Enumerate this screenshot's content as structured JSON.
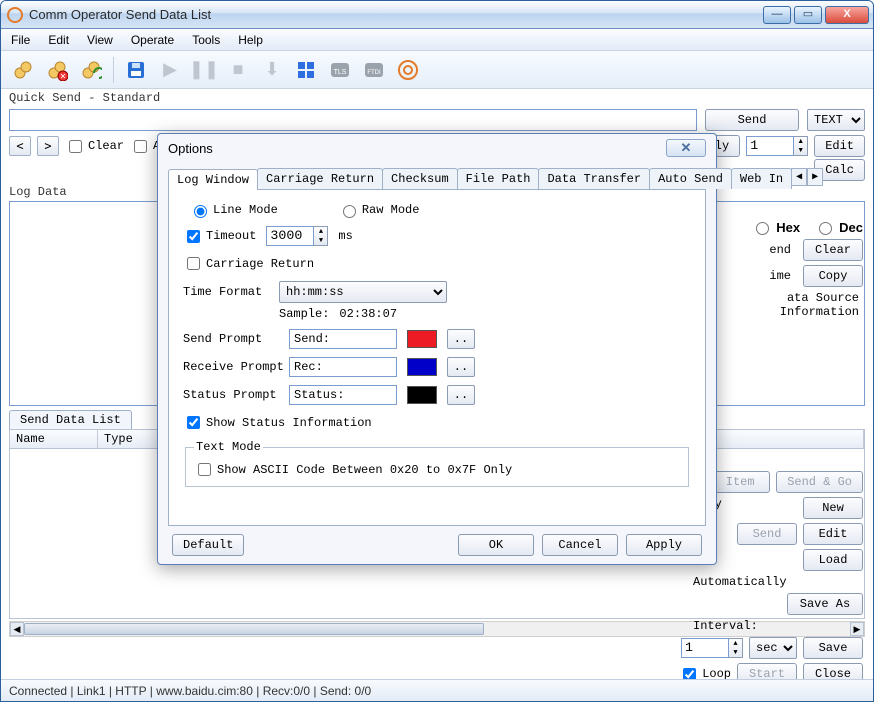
{
  "window": {
    "title": "Comm Operator   Send Data List"
  },
  "menubar": [
    "File",
    "Edit",
    "View",
    "Operate",
    "Tools",
    "Help"
  ],
  "quicksend_label": "Quick Send - Standard",
  "buttons": {
    "send": "Send",
    "text": "TEXT",
    "edit": "Edit",
    "calc": "Calc",
    "repeatedly": "Repeatedly",
    "clear": "Clear",
    "copy": "Copy",
    "item": "Item",
    "sendgo": "Send & Go",
    "new": "New",
    "load": "Load",
    "saveas": "Save As",
    "save": "Save",
    "close": "Close",
    "start": "Start",
    "send2": "Send"
  },
  "row2": {
    "clear": "Clear",
    "a_label": "A",
    "repeat_value": "1"
  },
  "log_label": "Log Data",
  "hexdec": {
    "hex": "Hex",
    "dec": "Dec"
  },
  "right_labels": {
    "end": "end",
    "ime": "ime",
    "datasrc": "ata Source Information",
    "edly": "edly",
    "auto": "Automatically",
    "interval": "Interval:",
    "loop": "Loop"
  },
  "interval": {
    "value": "1",
    "unit": "sec"
  },
  "sdl": {
    "tab": "Send Data List",
    "cols": [
      "Name",
      "Type"
    ]
  },
  "statusbar": "Connected | Link1 | HTTP | www.baidu.cim:80 | Recv:0/0 | Send: 0/0",
  "dialog": {
    "title": "Options",
    "tabs": [
      "Log Window",
      "Carriage Return",
      "Checksum",
      "File Path",
      "Data Transfer",
      "Auto Send",
      "Web In"
    ],
    "active_tab": 0,
    "mode": {
      "line": "Line Mode",
      "raw": "Raw Mode"
    },
    "timeout": {
      "label": "Timeout",
      "value": "3000",
      "unit": "ms"
    },
    "carriage_return": "Carriage Return",
    "time_format": {
      "label": "Time Format",
      "value": "hh:mm:ss",
      "sample_label": "Sample:",
      "sample_value": "02:38:07"
    },
    "send_prompt": {
      "label": "Send Prompt",
      "value": "Send:",
      "color": "#ed1c24"
    },
    "recv_prompt": {
      "label": "Receive Prompt",
      "value": "Rec:",
      "color": "#0000c8"
    },
    "status_prompt": {
      "label": "Status Prompt",
      "value": "Status:",
      "color": "#000000"
    },
    "show_status": "Show Status Information",
    "text_mode": {
      "legend": "Text Mode",
      "ascii_only": "Show ASCII Code Between 0x20 to 0x7F Only"
    },
    "buttons": {
      "default": "Default",
      "ok": "OK",
      "cancel": "Cancel",
      "apply": "Apply"
    }
  }
}
